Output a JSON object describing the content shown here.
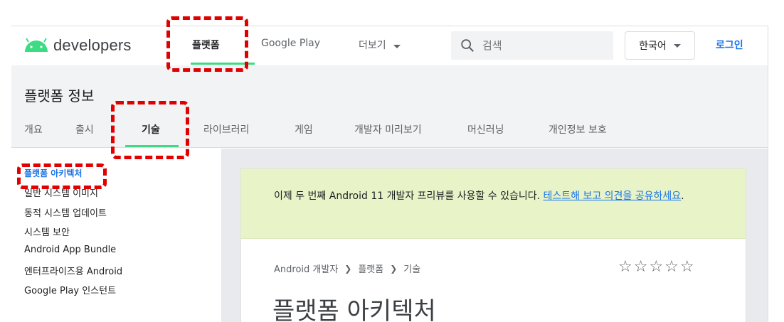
{
  "header": {
    "logo_text": "developers",
    "tabs": [
      {
        "label": "플랫폼"
      },
      {
        "label": "Google Play"
      },
      {
        "label": "더보기"
      }
    ],
    "search": {
      "placeholder": "검색"
    },
    "language": "한국어",
    "login": "로그인"
  },
  "section": {
    "title": "플랫폼 정보",
    "tabs": [
      {
        "label": "개요"
      },
      {
        "label": "출시"
      },
      {
        "label": "기술"
      },
      {
        "label": "라이브러리"
      },
      {
        "label": "게임"
      },
      {
        "label": "개발자 미리보기"
      },
      {
        "label": "머신러닝"
      },
      {
        "label": "개인정보 보호"
      }
    ]
  },
  "sidebar": {
    "items": [
      {
        "label": "플랫폼 아키텍처"
      },
      {
        "label": "일반 시스템 이미지"
      },
      {
        "label": "동적 시스템 업데이트"
      },
      {
        "label": "시스템 보안"
      },
      {
        "label": "Android App Bundle"
      },
      {
        "label": "엔터프라이즈용 Android"
      },
      {
        "label": "Google Play 인스턴트"
      }
    ]
  },
  "banner": {
    "text": "이제 두 번째 Android 11 개발자 프리뷰를 사용할 수 있습니다. ",
    "link": "테스트해 보고 의견을 공유하세요",
    "suffix": "."
  },
  "breadcrumb": [
    "Android 개발자",
    "플랫폼",
    "기술"
  ],
  "rating_stars": "☆☆☆☆☆",
  "page_title": "플랫폼 아키텍처",
  "colors": {
    "accent_green": "#3ddc84",
    "link_blue": "#1a73e8",
    "callout_red": "#e00000",
    "banner_bg": "#e8f4c8"
  }
}
